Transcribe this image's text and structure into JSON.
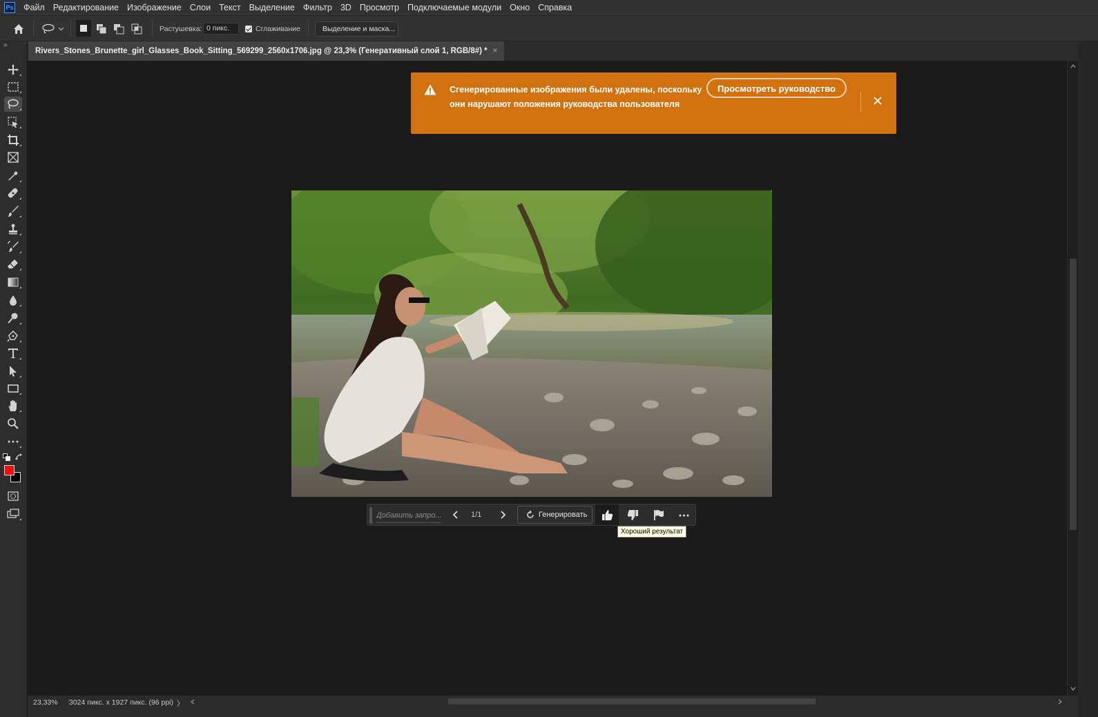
{
  "app": {
    "logo_text": "Ps"
  },
  "menu": [
    "Файл",
    "Редактирование",
    "Изображение",
    "Слои",
    "Текст",
    "Выделение",
    "Фильтр",
    "3D",
    "Просмотр",
    "Подключаемые модули",
    "Окно",
    "Справка"
  ],
  "options": {
    "feather_label": "Растушевка:",
    "feather_value": "0 пикс.",
    "antialias_label": "Сглаживание",
    "antialias_checked": true,
    "select_mask_label": "Выделение и маска..."
  },
  "document": {
    "tab_title": "Rivers_Stones_Brunette_girl_Glasses_Book_Sitting_569299_2560x1706.jpg @ 23,3% (Генеративный слой 1, RGB/8#) *",
    "close_glyph": "×"
  },
  "notification": {
    "message": "Сгенерированные изображения были удалены, поскольку они нарушают положения руководства пользователя",
    "guide_button": "Просмотреть руководство",
    "background_color": "#d2710f"
  },
  "taskbar": {
    "prompt_placeholder": "Добавить запро...",
    "counter": "1/1",
    "generate_label": "Генерировать",
    "tooltip": "Хороший результат"
  },
  "status": {
    "zoom": "23,33%",
    "doc_info": "3024 пикс. x 1927 пикс. (96 ppi)",
    "arrow": "〉"
  },
  "colors": {
    "foreground": "#f50d0d",
    "background": "#000000",
    "accent": "#31a8ff"
  },
  "tools": [
    "move-icon",
    "marquee-icon",
    "lasso-icon",
    "object-select-icon",
    "crop-icon",
    "frame-icon",
    "eyedropper-icon",
    "healing-icon",
    "brush-icon",
    "stamp-icon",
    "history-brush-icon",
    "eraser-icon",
    "gradient-icon",
    "blur-icon",
    "dodge-icon",
    "pen-icon",
    "type-icon",
    "path-select-icon",
    "rectangle-icon",
    "hand-icon",
    "zoom-icon",
    "more-tools-icon"
  ]
}
